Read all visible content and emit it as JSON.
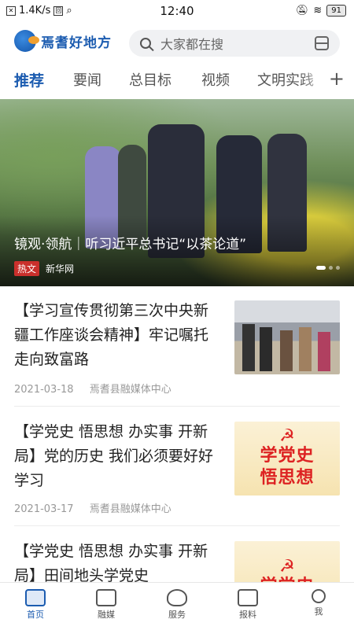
{
  "status_bar": {
    "speed": "1.4K/s",
    "time": "12:40",
    "battery": "91"
  },
  "header": {
    "logo_text": "焉耆好地方",
    "search_placeholder": "大家都在搜"
  },
  "tabs": [
    {
      "label": "推荐",
      "active": true
    },
    {
      "label": "要闻"
    },
    {
      "label": "总目标"
    },
    {
      "label": "视频"
    },
    {
      "label": "文明实践"
    }
  ],
  "hero": {
    "title": "镜观·领航｜听习近平总书记“以茶论道”",
    "badge": "热文",
    "source": "新华网"
  },
  "articles": [
    {
      "title": "【学习宣传贯彻第三次中央新疆工作座谈会精神】牢记嘱托  走向致富路",
      "date": "2021-03-18",
      "source": "焉耆县融媒体中心"
    },
    {
      "title": "【学党史 悟思想 办实事 开新局】党的历史 我们必须要好好学习",
      "date": "2021-03-17",
      "source": "焉耆县融媒体中心",
      "thumb_lines": [
        "学党史",
        "悟思想"
      ]
    },
    {
      "title": "【学党史 悟思想 办实事 开新局】田间地头学党史",
      "thumb_lines": [
        "学党史"
      ]
    }
  ],
  "bottom_nav": [
    {
      "label": "首页",
      "icon": "newspaper-icon",
      "active": true
    },
    {
      "label": "融媒",
      "icon": "media-icon"
    },
    {
      "label": "服务",
      "icon": "heart-icon"
    },
    {
      "label": "报料",
      "icon": "report-icon"
    },
    {
      "label": "我",
      "icon": "person-icon"
    }
  ],
  "colors": {
    "accent": "#1c5cb0",
    "hot_badge": "#c9302c",
    "party_red": "#dd2222"
  }
}
